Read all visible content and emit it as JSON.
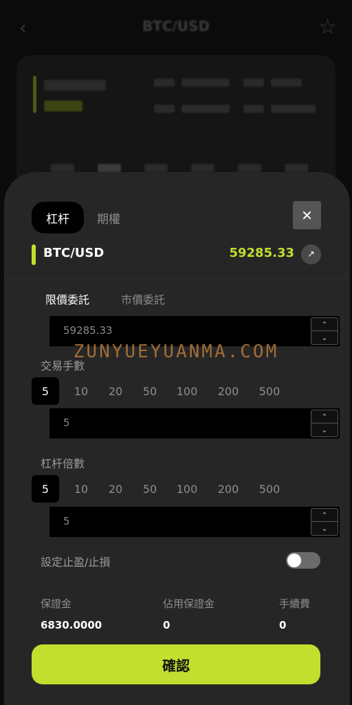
{
  "background": {
    "title": "BTC/USD"
  },
  "sheet": {
    "tabs": [
      {
        "label": "杠杆",
        "active": true
      },
      {
        "label": "期權",
        "active": false
      }
    ],
    "pair": {
      "name": "BTC/USD",
      "price": "59285.33"
    },
    "order_tabs": [
      {
        "label": "限價委託",
        "active": true
      },
      {
        "label": "市價委託",
        "active": false
      }
    ],
    "limit_price": "59285.33",
    "lots": {
      "label": "交易手數",
      "options": [
        "5",
        "10",
        "20",
        "50",
        "100",
        "200",
        "500"
      ],
      "selected": "5",
      "value": "5"
    },
    "leverage": {
      "label": "杠杆倍數",
      "options": [
        "5",
        "10",
        "20",
        "50",
        "100",
        "200",
        "500"
      ],
      "selected": "5",
      "value": "5"
    },
    "tp_sl": {
      "label": "設定止盈/止損",
      "enabled": false
    },
    "stats": [
      {
        "label": "保證金",
        "value": "6830.0000"
      },
      {
        "label": "佔用保證金",
        "value": "0"
      },
      {
        "label": "手續費",
        "value": "0"
      }
    ],
    "confirm_label": "確認"
  },
  "watermark": "ZUNYUEYUANMA.COM",
  "colors": {
    "accent": "#c2de2e",
    "sheet": "#262626"
  }
}
